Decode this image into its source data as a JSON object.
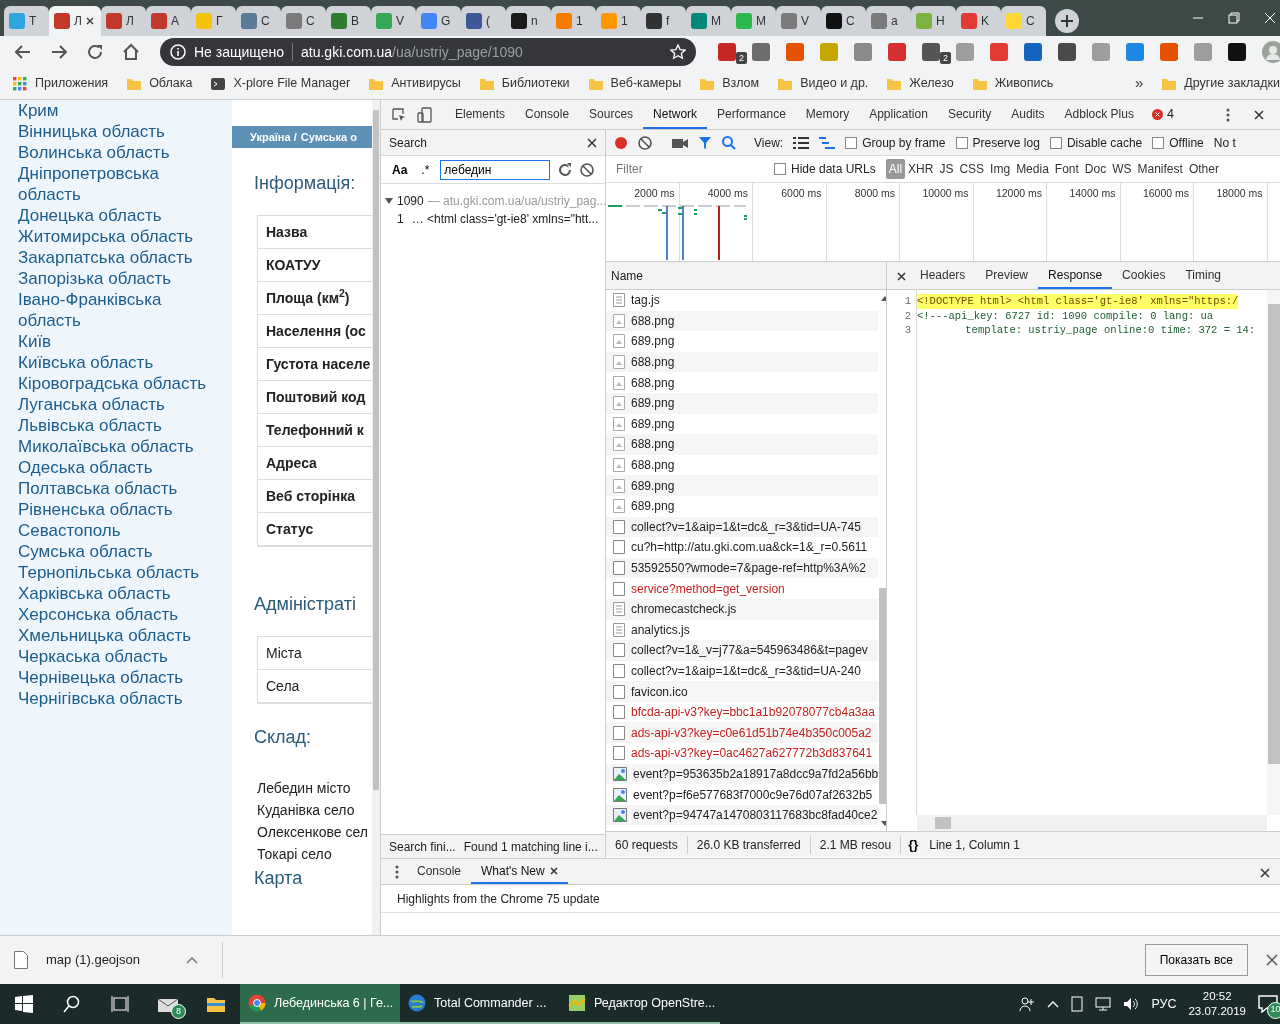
{
  "browser": {
    "tabs": [
      {
        "title": "T",
        "color": "#2ca5e0",
        "selected": false
      },
      {
        "title": "Л",
        "color": "#c0392b",
        "selected": true
      },
      {
        "title": "Л",
        "color": "#c0392b",
        "selected": false
      },
      {
        "title": "A",
        "color": "#c0392b",
        "selected": false
      },
      {
        "title": "Г",
        "color": "#f4c20d",
        "selected": false
      },
      {
        "title": "C",
        "color": "#5b7c99",
        "selected": false
      },
      {
        "title": "C",
        "color": "#7a7a7a",
        "selected": false
      },
      {
        "title": "B",
        "color": "#2e7d32",
        "selected": false
      },
      {
        "title": "V",
        "color": "#34a853",
        "selected": false
      },
      {
        "title": "G",
        "color": "#4285f4",
        "selected": false
      },
      {
        "title": "(",
        "color": "#3b5998",
        "selected": false
      },
      {
        "title": "n",
        "color": "#1b1b1b",
        "selected": false
      },
      {
        "title": "1",
        "color": "#f57c00",
        "selected": false
      },
      {
        "title": "1",
        "color": "#ff9800",
        "selected": false
      },
      {
        "title": "f",
        "color": "#333333",
        "selected": false
      },
      {
        "title": "M",
        "color": "#00897b",
        "selected": false
      },
      {
        "title": "M",
        "color": "#2db84d",
        "selected": false
      },
      {
        "title": "V",
        "color": "#7a7a7a",
        "selected": false
      },
      {
        "title": "C",
        "color": "#111111",
        "selected": false
      },
      {
        "title": "a",
        "color": "#7a7a7a",
        "selected": false
      },
      {
        "title": "H",
        "color": "#7cb342",
        "selected": false
      },
      {
        "title": "K",
        "color": "#e53935",
        "selected": false
      },
      {
        "title": "C",
        "color": "#fdd835",
        "selected": false
      }
    ],
    "omnibox": {
      "security": "Не защищено",
      "host": "atu.gki.com.ua",
      "path": "/ua/ustriy_page/1090"
    },
    "extensions": [
      {
        "color": "#c62828",
        "badge": "2"
      },
      {
        "color": "#6d6d6d"
      },
      {
        "color": "#e65100"
      },
      {
        "color": "#c6a700"
      },
      {
        "color": "#8a8a8a"
      },
      {
        "color": "#d32f2f"
      },
      {
        "color": "#555555",
        "badge": "2"
      },
      {
        "color": "#9e9e9e"
      },
      {
        "color": "#e53935"
      },
      {
        "color": "#1565c0"
      },
      {
        "color": "#4a4a4a"
      },
      {
        "color": "#9e9e9e"
      },
      {
        "color": "#1e88e5"
      },
      {
        "color": "#e65100"
      },
      {
        "color": "#9e9e9e"
      },
      {
        "color": "#111111"
      }
    ],
    "bookmarks": [
      {
        "kind": "apps",
        "label": "Приложения"
      },
      {
        "kind": "folder",
        "label": "Облака"
      },
      {
        "kind": "app",
        "label": "X-plore File Manager"
      },
      {
        "kind": "folder",
        "label": "Антивирусы"
      },
      {
        "kind": "folder",
        "label": "Библиотеки"
      },
      {
        "kind": "folder",
        "label": "Веб-камеры"
      },
      {
        "kind": "folder",
        "label": "Взлом"
      },
      {
        "kind": "folder",
        "label": "Видео и др."
      },
      {
        "kind": "folder",
        "label": "Железо"
      },
      {
        "kind": "folder",
        "label": "Живопись"
      }
    ],
    "bookmarks_more": "»",
    "other_bookmarks": "Другие закладки"
  },
  "page": {
    "regions": [
      "Крим",
      "Вінницька область",
      "Волинська область",
      "Дніпропетровська область",
      "Донецька область",
      "Житомирська область",
      "Закарпатська область",
      "Запорізька область",
      "Івано-Франківська область",
      "Київ",
      "Київська область",
      "Кіровоградська область",
      "Луганська область",
      "Львівська область",
      "Миколаївська область",
      "Одеська область",
      "Полтавська область",
      "Рівненська область",
      "Севастополь",
      "Сумська область",
      "Тернопільська область",
      "Харківська область",
      "Херсонська область",
      "Хмельницька область",
      "Черкаська область",
      "Чернівецька область",
      "Чернігівська область"
    ],
    "breadcrumb": [
      "Україна /",
      "Сумська о"
    ],
    "info_heading": "Інформація:",
    "info_rows": [
      "Назва",
      "КОАТУУ",
      "Площа (км$^{2}$)",
      "Населення (ос",
      "Густота населе",
      "Поштовий код",
      "Телефонний к",
      "Адреса",
      "Веб сторінка",
      "Статус"
    ],
    "admin_heading": "Адміністраті",
    "admin_rows": [
      "Міста",
      "Села"
    ],
    "composition_heading": "Склад:",
    "composition": [
      "Лебедин місто",
      "Куданівка село",
      "Олексенкове сел",
      "Токарі село"
    ],
    "map_heading": "Карта"
  },
  "devtools": {
    "tabs": [
      {
        "label": "Elements",
        "selected": false
      },
      {
        "label": "Console",
        "selected": false
      },
      {
        "label": "Sources",
        "selected": false
      },
      {
        "label": "Network",
        "selected": true
      },
      {
        "label": "Performance",
        "selected": false
      },
      {
        "label": "Memory",
        "selected": false
      },
      {
        "label": "Application",
        "selected": false
      },
      {
        "label": "Security",
        "selected": false
      },
      {
        "label": "Audits",
        "selected": false
      },
      {
        "label": "Adblock Plus",
        "selected": false
      }
    ],
    "error_count": "4",
    "search": {
      "title": "Search",
      "case_toggle": "Aa",
      "regex_toggle": ".*",
      "query": "лебедин",
      "result_file": "1090",
      "result_url": "— atu.gki.com.ua/ua/ustriy_pag...",
      "match_line": "1",
      "match_text": "… <html class='gt-ie8' xmlns=\"htt...",
      "status": "Search fini...",
      "status_found": "Found 1 matching line i..."
    },
    "network": {
      "view_label": "View:",
      "options": [
        {
          "label": "Group by frame",
          "checked": false
        },
        {
          "label": "Preserve log",
          "checked": false
        },
        {
          "label": "Disable cache",
          "checked": false
        },
        {
          "label": "Offline",
          "checked": false
        }
      ],
      "throttle": "No t",
      "filter_placeholder": "Filter",
      "hide_data_urls": {
        "label": "Hide data URLs",
        "checked": false
      },
      "types": [
        {
          "label": "All",
          "selected": true
        },
        {
          "label": "XHR",
          "selected": false
        },
        {
          "label": "JS",
          "selected": false
        },
        {
          "label": "CSS",
          "selected": false
        },
        {
          "label": "Img",
          "selected": false
        },
        {
          "label": "Media",
          "selected": false
        },
        {
          "label": "Font",
          "selected": false
        },
        {
          "label": "Doc",
          "selected": false
        },
        {
          "label": "WS",
          "selected": false
        },
        {
          "label": "Manifest",
          "selected": false
        },
        {
          "label": "Other",
          "selected": false
        }
      ],
      "ticks": [
        "2000 ms",
        "4000 ms",
        "6000 ms",
        "8000 ms",
        "10000 ms",
        "12000 ms",
        "14000 ms",
        "16000 ms",
        "18000 ms"
      ],
      "name_header": "Name",
      "requests": [
        {
          "name": "tag.js",
          "kind": "script",
          "failed": false
        },
        {
          "name": "688.png",
          "kind": "image",
          "failed": false
        },
        {
          "name": "689.png",
          "kind": "image",
          "failed": false
        },
        {
          "name": "688.png",
          "kind": "image",
          "failed": false
        },
        {
          "name": "688.png",
          "kind": "image",
          "failed": false
        },
        {
          "name": "689.png",
          "kind": "image",
          "failed": false
        },
        {
          "name": "689.png",
          "kind": "image",
          "failed": false
        },
        {
          "name": "688.png",
          "kind": "image",
          "failed": false
        },
        {
          "name": "688.png",
          "kind": "image",
          "failed": false
        },
        {
          "name": "689.png",
          "kind": "image",
          "failed": false
        },
        {
          "name": "689.png",
          "kind": "image",
          "failed": false
        },
        {
          "name": "collect?v=1&aip=1&t=dc&_r=3&tid=UA-745",
          "kind": "other",
          "failed": false
        },
        {
          "name": "cu?h=http://atu.gki.com.ua&ck=1&_r=0.5611",
          "kind": "other",
          "failed": false
        },
        {
          "name": "53592550?wmode=7&page-ref=http%3A%2",
          "kind": "other",
          "failed": false
        },
        {
          "name": "service?method=get_version",
          "kind": "other",
          "failed": true
        },
        {
          "name": "chromecastcheck.js",
          "kind": "script",
          "failed": false
        },
        {
          "name": "analytics.js",
          "kind": "script",
          "failed": false
        },
        {
          "name": "collect?v=1&_v=j77&a=545963486&t=pagev",
          "kind": "other",
          "failed": false
        },
        {
          "name": "collect?v=1&aip=1&t=dc&_r=3&tid=UA-240",
          "kind": "other",
          "failed": false
        },
        {
          "name": "favicon.ico",
          "kind": "other",
          "failed": false
        },
        {
          "name": "bfcda-api-v3?key=bbc1a1b92078077cb4a3aa",
          "kind": "other",
          "failed": true
        },
        {
          "name": "ads-api-v3?key=c0e61d51b74e4b350c005a2",
          "kind": "other",
          "failed": true
        },
        {
          "name": "ads-api-v3?key=0ac4627a627772b3d837641",
          "kind": "other",
          "failed": true
        },
        {
          "name": "event?p=953635b2a18917a8dcc9a7fd2a56bb",
          "kind": "picture",
          "failed": false
        },
        {
          "name": "event?p=f6e577683f7000c9e76d07af2632b5",
          "kind": "picture",
          "failed": false
        },
        {
          "name": "event?p=94747a1470803117683bc8fad40ce2",
          "kind": "picture",
          "failed": false
        }
      ],
      "summary": [
        "60 requests",
        "26.0 KB transferred",
        "2.1 MB resou"
      ],
      "detail_tabs": [
        {
          "label": "Headers",
          "selected": false
        },
        {
          "label": "Preview",
          "selected": false
        },
        {
          "label": "Response",
          "selected": true
        },
        {
          "label": "Cookies",
          "selected": false
        },
        {
          "label": "Timing",
          "selected": false
        }
      ],
      "code": [
        {
          "number": "1",
          "text": "<!DOCTYPE html> <html class='gt-ie8' xmlns=\"https:/",
          "highlighted": true,
          "wrapped": false
        },
        {
          "number": "2",
          "text": "<!---api_key: 6727 id: 1090 compile: 0 lang: ua",
          "highlighted": false,
          "wrapped": false
        },
        {
          "number": "3",
          "text": "template: ustriy_page online:0 time: 372 = 14:",
          "highlighted": false,
          "wrapped": true
        }
      ],
      "pretty_print": "{}",
      "cursor": "Line 1, Column 1"
    },
    "drawer": {
      "tabs": [
        {
          "label": "Console",
          "selected": false,
          "closable": false
        },
        {
          "label": "What's New",
          "selected": true,
          "closable": true
        }
      ],
      "headline": "Highlights from the Chrome 75 update"
    }
  },
  "downloads": {
    "file": "map (1).geojson",
    "show_all": "Показать все"
  },
  "taskbar": {
    "mail_badge": "8",
    "apps": [
      {
        "label": "Лебединська 6 | Ге...",
        "kind": "chrome",
        "selected": true
      },
      {
        "label": "Total Commander ...",
        "kind": "commander",
        "selected": false
      },
      {
        "label": "Редактор OpenStre...",
        "kind": "map",
        "selected": false
      }
    ],
    "language": "РУС",
    "time": "20:52",
    "date": "23.07.2019",
    "notifications": "10"
  }
}
